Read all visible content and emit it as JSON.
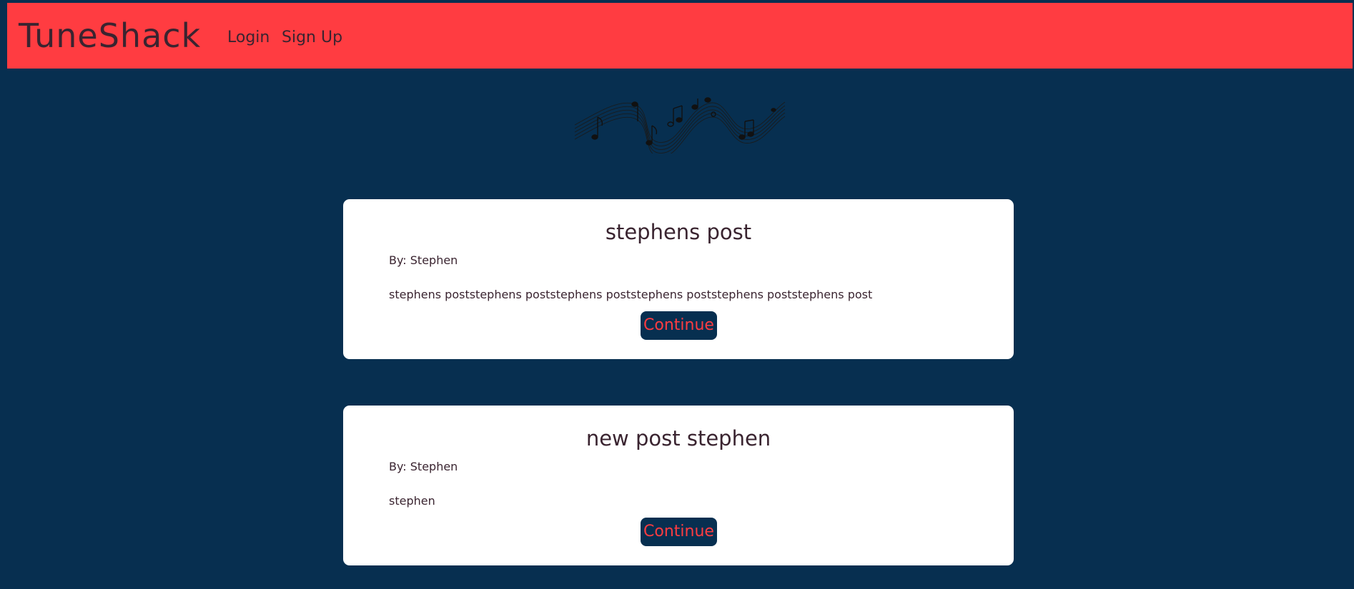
{
  "header": {
    "brand": "TuneShack",
    "nav": [
      {
        "label": "Login"
      },
      {
        "label": "Sign Up"
      }
    ],
    "accent_color": "#ff3c41"
  },
  "banner": {
    "icon": "music-notes-staff-icon"
  },
  "posts": [
    {
      "title": "stephens post",
      "author": "By: Stephen",
      "body": "stephens poststephens poststephens poststephens poststephens poststephens post",
      "button_label": "Continue"
    },
    {
      "title": "new post stephen",
      "author": "By: Stephen",
      "body": "stephen",
      "button_label": "Continue"
    }
  ],
  "colors": {
    "background": "#072f50",
    "card": "#ffffff",
    "text": "#3a2430"
  }
}
